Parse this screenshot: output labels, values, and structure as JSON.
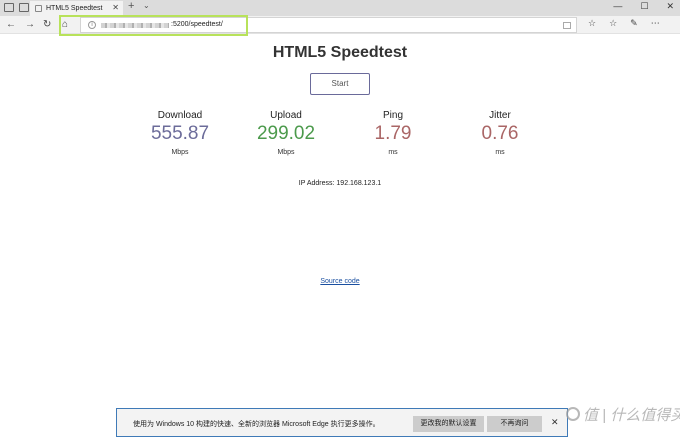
{
  "browser": {
    "tab_title": "HTML5 Speedtest",
    "tab_close": "✕",
    "new_tab": "+",
    "tab_list": "⌄",
    "win_minimize": "—",
    "win_maximize": "☐",
    "win_close": "✕",
    "nav_back": "←",
    "nav_forward": "→",
    "nav_refresh": "↻",
    "nav_home": "⌂",
    "url_visible": ":5200/speedtest/",
    "url_info": "i",
    "tool_favorites": "☆",
    "tool_hub": "☆",
    "tool_share": "✎",
    "tool_more": "⋯"
  },
  "page": {
    "title": "HTML5 Speedtest",
    "start_label": "Start",
    "metrics": [
      {
        "label": "Download",
        "value": "555.87",
        "unit": "Mbps",
        "color": "#6c6c9a"
      },
      {
        "label": "Upload",
        "value": "299.02",
        "unit": "Mbps",
        "color": "#4c9a4c"
      },
      {
        "label": "Ping",
        "value": "1.79",
        "unit": "ms",
        "color": "#aa6666"
      },
      {
        "label": "Jitter",
        "value": "0.76",
        "unit": "ms",
        "color": "#aa6666"
      }
    ],
    "ip_address": "IP Address: 192.168.123.1",
    "source_code": "Source code"
  },
  "notification": {
    "text": "使用为 Windows 10 构建的快速、全新的浏览器 Microsoft Edge 执行更多操作。",
    "button_default": "更改我的默认设置",
    "button_never": "不再询问",
    "close": "✕"
  },
  "watermark": {
    "text": "值 | 什么值得买"
  }
}
